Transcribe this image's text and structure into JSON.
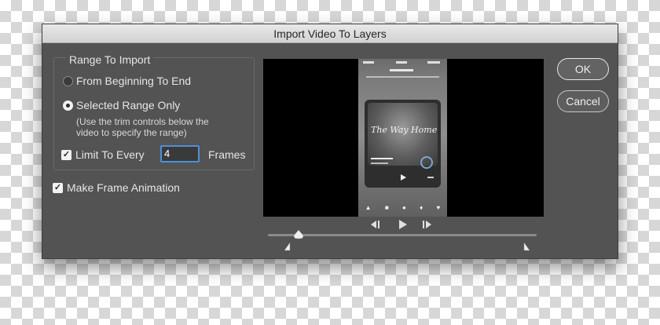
{
  "dialog": {
    "title": "Import Video To Layers",
    "range_group": {
      "label": "Range To Import",
      "option_full": "From Beginning To End",
      "option_selected": "Selected Range Only",
      "hint_line1": "(Use the trim controls below the",
      "hint_line2": "video to specify the range)",
      "limit_label": "Limit To Every",
      "limit_value": "4",
      "frames_label": "Frames",
      "selected_option": "Selected Range Only",
      "limit_checked": true
    },
    "make_frame_animation": {
      "label": "Make Frame Animation",
      "checked": true
    },
    "buttons": {
      "ok": "OK",
      "cancel": "Cancel"
    },
    "preview": {
      "card_title": "The Way Home",
      "controls": [
        "step-back-icon",
        "play-icon",
        "step-forward-icon"
      ]
    },
    "colors": {
      "dialog_bg": "#535353",
      "focus_ring": "#4d90d9",
      "text": "#e6e6e6"
    }
  }
}
